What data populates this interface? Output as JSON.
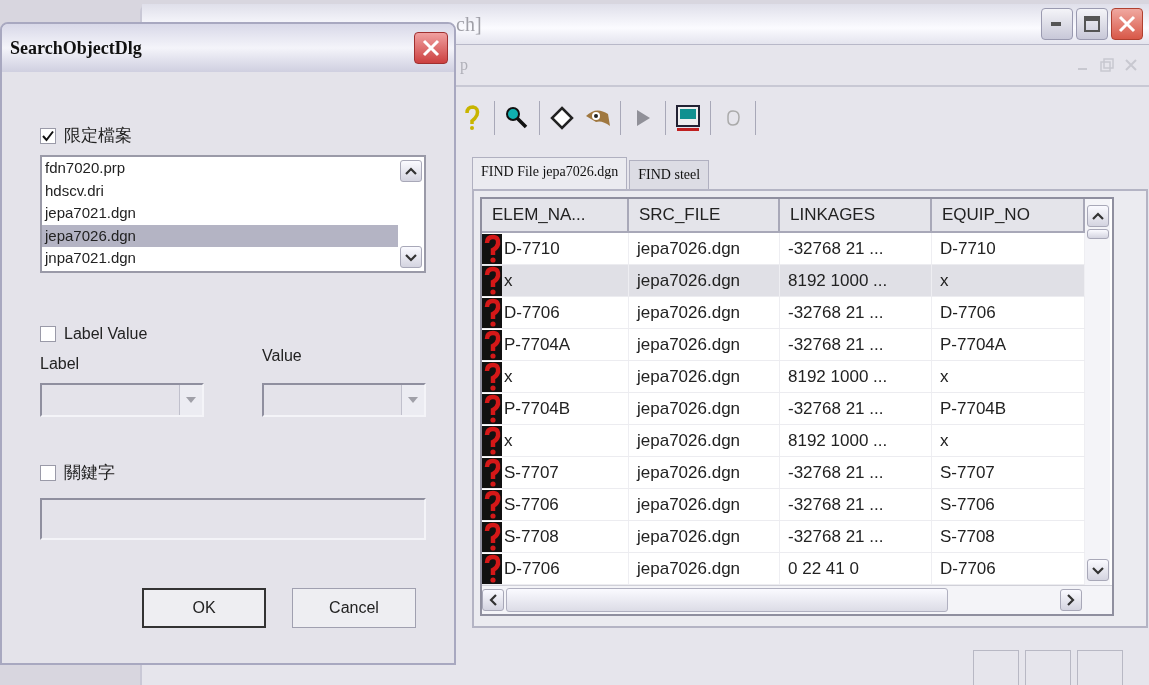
{
  "main_window": {
    "title": "ch]",
    "menu": [
      "p"
    ],
    "tabs": [
      {
        "label": "FIND File jepa7026.dgn",
        "selected": true
      },
      {
        "label": "FIND steel",
        "selected": false
      }
    ],
    "table": {
      "columns": [
        "ELEM_NA...",
        "SRC_FILE",
        "LINKAGES",
        "EQUIP_NO"
      ],
      "rows": [
        {
          "cells": [
            "D-7710",
            "jepa7026.dgn",
            "-32768 21 ...",
            "D-7710"
          ],
          "selected": false
        },
        {
          "cells": [
            "x",
            "jepa7026.dgn",
            "8192 1000 ...",
            "x"
          ],
          "selected": true
        },
        {
          "cells": [
            "D-7706",
            "jepa7026.dgn",
            "-32768 21 ...",
            "D-7706"
          ],
          "selected": false
        },
        {
          "cells": [
            "P-7704A",
            "jepa7026.dgn",
            "-32768 21 ...",
            "P-7704A"
          ],
          "selected": false
        },
        {
          "cells": [
            "x",
            "jepa7026.dgn",
            "8192 1000 ...",
            "x"
          ],
          "selected": false
        },
        {
          "cells": [
            "P-7704B",
            "jepa7026.dgn",
            "-32768 21 ...",
            "P-7704B"
          ],
          "selected": false
        },
        {
          "cells": [
            "x",
            "jepa7026.dgn",
            "8192 1000 ...",
            "x"
          ],
          "selected": false
        },
        {
          "cells": [
            "S-7707",
            "jepa7026.dgn",
            "-32768 21 ...",
            "S-7707"
          ],
          "selected": false
        },
        {
          "cells": [
            "S-7706",
            "jepa7026.dgn",
            "-32768 21 ...",
            "S-7706"
          ],
          "selected": false
        },
        {
          "cells": [
            "S-7708",
            "jepa7026.dgn",
            "-32768 21 ...",
            "S-7708"
          ],
          "selected": false
        },
        {
          "cells": [
            "D-7706",
            "jepa7026.dgn",
            "0 22 41 0",
            "D-7706"
          ],
          "selected": false
        }
      ]
    }
  },
  "dialog": {
    "title": "SearchObjectDlg",
    "limit_file": {
      "label": "限定檔案",
      "checked": true
    },
    "files": [
      {
        "name": "fdn7020.prp",
        "selected": false
      },
      {
        "name": "hdscv.dri",
        "selected": false
      },
      {
        "name": "jepa7021.dgn",
        "selected": false
      },
      {
        "name": "jepa7026.dgn",
        "selected": true
      },
      {
        "name": "jnpa7021.dgn",
        "selected": false
      }
    ],
    "label_value": {
      "label": "Label Value",
      "checked": false
    },
    "label_field": {
      "label": "Label",
      "disabled": true
    },
    "value_field": {
      "label": "Value",
      "disabled": true
    },
    "keyword": {
      "label": "關鍵字",
      "checked": false
    },
    "keyword_field": {
      "disabled": true
    },
    "buttons": [
      {
        "label": "OK",
        "default": true
      },
      {
        "label": "Cancel",
        "default": false
      }
    ]
  }
}
